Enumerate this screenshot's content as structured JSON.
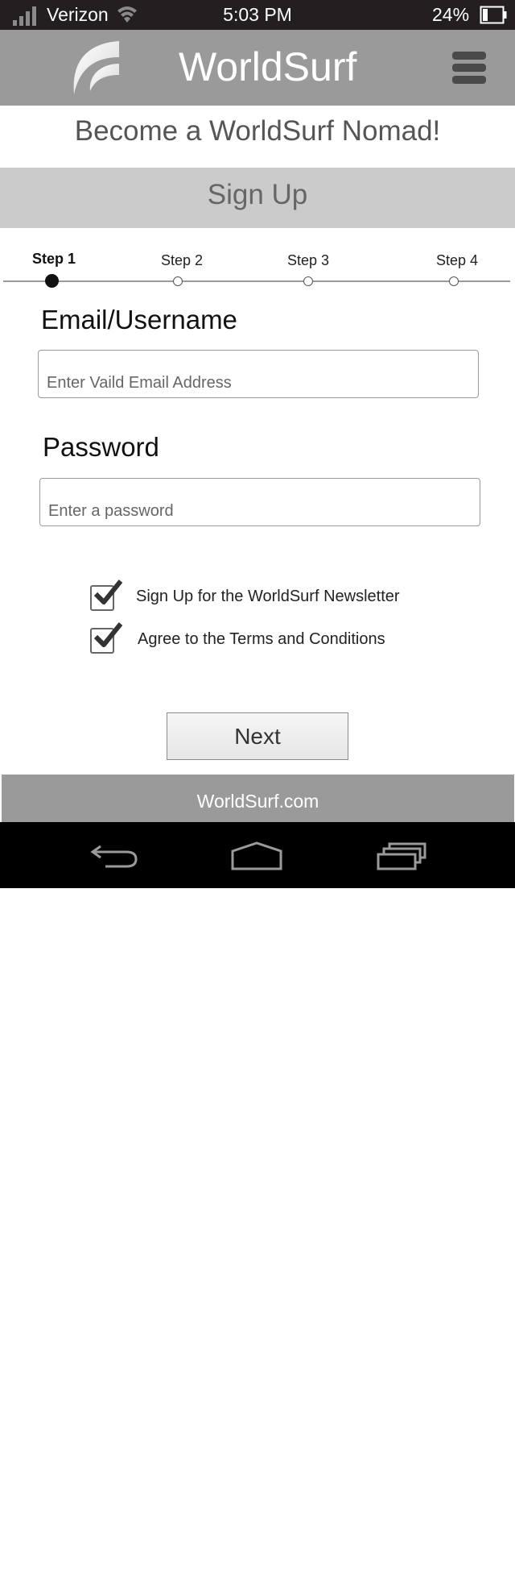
{
  "status_bar": {
    "carrier": "Verizon",
    "time": "5:03 PM",
    "battery_percent": "24%",
    "icons": [
      "signal-icon",
      "wifi-icon",
      "battery-icon"
    ]
  },
  "header": {
    "title": "WorldSurf",
    "logo_icon": "worldsurf-wave-logo",
    "menu_icon": "hamburger-menu-icon"
  },
  "tagline": "Become a WorldSurf Nomad!",
  "signup_banner": "Sign Up",
  "stepper": {
    "steps": [
      {
        "label": "Step 1",
        "active": true
      },
      {
        "label": "Step 2",
        "active": false
      },
      {
        "label": "Step 3",
        "active": false
      },
      {
        "label": "Step 4",
        "active": false
      }
    ]
  },
  "form": {
    "email": {
      "label": "Email/Username",
      "value": "",
      "placeholder": "Enter Vaild Email Address"
    },
    "password": {
      "label": "Password",
      "value": "",
      "placeholder": "Enter a password"
    },
    "checkboxes": [
      {
        "label": "Sign Up for the WorldSurf Newsletter",
        "checked": true
      },
      {
        "label": "Agree to the Terms and Conditions",
        "checked": true
      }
    ],
    "next_label": "Next"
  },
  "footer": {
    "text": "WorldSurf.com"
  },
  "nav_bar": {
    "icons": [
      "back-icon",
      "home-icon",
      "recent-apps-icon"
    ]
  },
  "colors": {
    "status_bar_bg": "#231f20",
    "header_bg": "#9a9a9a",
    "banner_bg": "#cbcbcb",
    "footer_bg": "#9a9a9a",
    "nav_bar_bg": "#000000"
  }
}
